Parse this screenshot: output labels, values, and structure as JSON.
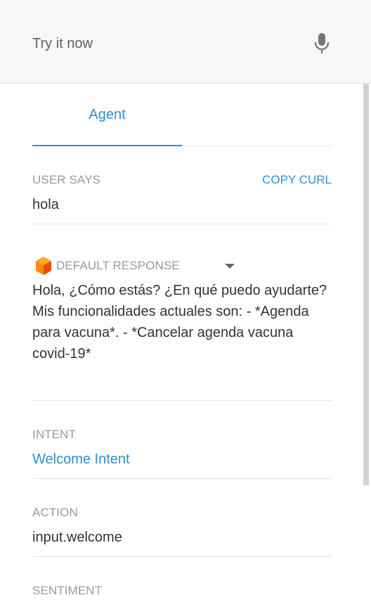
{
  "try_it": {
    "placeholder": "Try it now",
    "mic_icon": "microphone-icon"
  },
  "tabs": [
    {
      "label": "Agent",
      "active": true
    }
  ],
  "user_says": {
    "label": "USER SAYS",
    "copy_curl": "COPY CURL",
    "value": "hola"
  },
  "default_response": {
    "icon": "orange-cube-icon",
    "label": "DEFAULT RESPONSE",
    "text": "Hola, ¿Cómo estás? ¿En qué puedo ayudarte? Mis funcionalidades actuales son: - *Agenda para vacuna*. - *Cancelar agenda vacuna covid-19*"
  },
  "intent": {
    "label": "INTENT",
    "value": "Welcome Intent"
  },
  "action": {
    "label": "ACTION",
    "value": "input.welcome"
  },
  "sentiment": {
    "label": "SENTIMENT"
  },
  "colors": {
    "accent": "#2b8fd6",
    "label_gray": "#9a9a9a",
    "cube_orange": "#f57c00"
  }
}
